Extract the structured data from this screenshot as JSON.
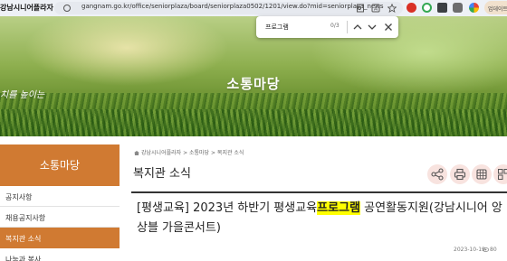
{
  "browser": {
    "site_logo": "강남시니어플라자",
    "url": "gangnam.go.kr/office/seniorplaza/board/seniorplaza0502/1201/view.do?mid=seniorplaza_news",
    "profile_label": "업데이트"
  },
  "find_bar": {
    "query": "프로그램",
    "count": "0/3"
  },
  "banner": {
    "title": "소통마당",
    "slogan": "치를 높이는"
  },
  "sidebar": {
    "title": "소통마당",
    "items": [
      {
        "label": "공지사항"
      },
      {
        "label": "채용공지사항"
      },
      {
        "label": "복지관 소식"
      },
      {
        "label": "나눔과 봉사"
      }
    ]
  },
  "breadcrumb": "강남시니어플라자 > 소통마당 > 복지관 소식",
  "page_title": "복지관 소식",
  "post": {
    "title_before": "[평생교육] 2023년 하반기 평생교육",
    "title_highlight": "프로그램",
    "title_after": " 공연활동지원(강남시니어 앙상블 가을콘서트)",
    "date": "2023-10-19",
    "views": "80"
  },
  "colors": {
    "accent": "#d07a32",
    "highlight": "#ffff00",
    "tool_bg": "#f8e3df"
  },
  "icons": [
    "share-icon",
    "print-icon",
    "copy-icon",
    "qr-icon",
    "search-icon",
    "close-icon",
    "chevron-up-icon",
    "chevron-down-icon"
  ]
}
